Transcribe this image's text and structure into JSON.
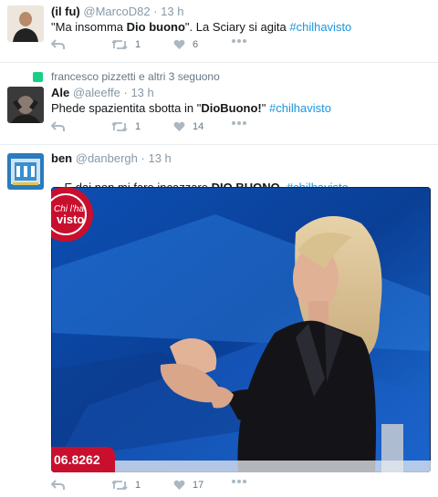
{
  "tweets": [
    {
      "name": "(il fu)",
      "handle": "@MarcoD82",
      "time": "13 h",
      "text_parts": [
        "\"Ma insomma ",
        "Dio buono",
        "\". La Sciary si agita ",
        "#chilhavisto"
      ],
      "retweets": "1",
      "likes": "6"
    },
    {
      "context": "francesco pizzetti e altri 3 seguono",
      "name": "Ale",
      "handle": "@aleeffe",
      "time": "13 h",
      "text_parts": [
        "Phede spazientita sbotta in \"",
        "DioBuono!",
        "\" ",
        "#chilhavisto"
      ],
      "retweets": "1",
      "likes": "14"
    },
    {
      "name": "ben",
      "handle": "@danbergh",
      "time": "13 h",
      "text_parts": [
        "E dai non mi fare incazzare ",
        "DIO BUONO",
        "  ",
        "#chilhavisto"
      ],
      "retweets": "1",
      "likes": "17",
      "media": {
        "logo_text": "Chi l'ha visto",
        "ticker": "06.8262"
      }
    }
  ],
  "separator": "·",
  "colors": {
    "link": "#1b95e0",
    "muted": "#8899a6",
    "action": "#aab8c2",
    "divider": "#e6ecf0"
  },
  "icons": [
    "reply-icon",
    "retweet-icon",
    "like-icon",
    "more-icon"
  ]
}
